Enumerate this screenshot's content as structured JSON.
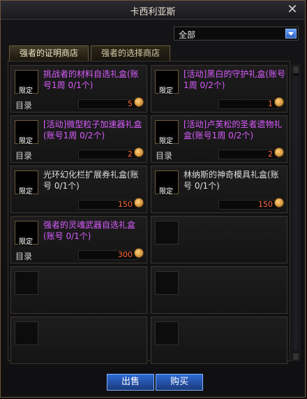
{
  "window": {
    "title": "卡西利亚斯"
  },
  "filter": {
    "selected": "全部"
  },
  "tabs": [
    {
      "label": "强者的证明商店"
    },
    {
      "label": "强者的选择商店"
    }
  ],
  "items": [
    {
      "name": "挑战者的材料自选礼盒(账号1周 0/1个)",
      "badge": "限定",
      "category": "目录",
      "price": "5"
    },
    {
      "name": "[活动]黑白的守护礼盒(账号1周 0/2个)",
      "badge": "限定",
      "category": "",
      "price": "1"
    },
    {
      "name": "[活动]微型粒子加速器礼盒(账号1周 0/2个)",
      "badge": "限定",
      "category": "目录",
      "price": "2"
    },
    {
      "name": "[活动]卢芙松的圣者遗物礼盒(账号1周 0/2个)",
      "badge": "限定",
      "category": "目录",
      "price": "2"
    },
    {
      "name": "光环幻化栏扩展券礼盒(账号 0/1个)",
      "badge": "限定",
      "category": "",
      "price": "150"
    },
    {
      "name": "林纳斯的神奇模具礼盒(账号 0/1个)",
      "badge": "限定",
      "category": "",
      "price": "150"
    },
    {
      "name": "强者的灵魂武器自选礼盒(账号 0/1个)",
      "badge": "限定",
      "category": "目录",
      "price": "300"
    }
  ],
  "buttons": {
    "sell": "出售",
    "buy": "购买"
  },
  "colors": {
    "item_name_purple": "#d85cff",
    "price_orange": "#ff6a3d",
    "button_blue": "#2e6ad6"
  }
}
